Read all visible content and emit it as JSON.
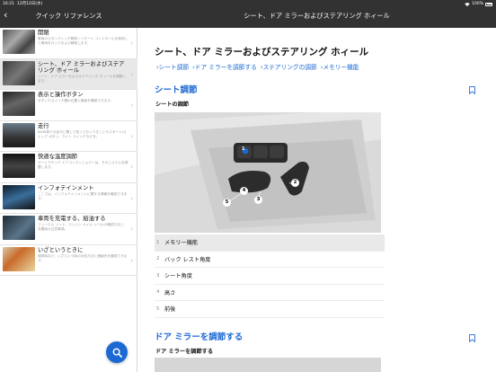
{
  "status": {
    "time": "16:21",
    "date": "12月12日(水)",
    "battery": "100%"
  },
  "sidebar": {
    "back_icon": "‹",
    "title": "クイック リファレンス",
    "items": [
      {
        "title": "開閉",
        "desc": "車両のスタンディング照明 / リモート コントロールを使用して車両をロックおよび解錠します。",
        "thumb": "t1"
      },
      {
        "title": "シート、ドア ミラーおよびステアリング ホィール",
        "desc": "シート、ドア ミラーおよびステアリング ホィールを調整します。",
        "thumb": "t2"
      },
      {
        "title": "表示と操作ボタン",
        "desc": "ボタンやスイッチ類の位置と機能を確認できます。",
        "thumb": "t3"
      },
      {
        "title": "走行",
        "desc": "BMW車での走行に関して知っておくべきことやスタート/ストップ ボタン、ライト スイッチなどを。",
        "thumb": "t4"
      },
      {
        "title": "快適な温度調節",
        "desc": "オートマチック エアコンディショナーは、そのシステムを調整します。",
        "thumb": "t5"
      },
      {
        "title": "インフォテインメント",
        "desc": "ここでは、インフォテインメントに関する情報を確認できます。",
        "thumb": "t6"
      },
      {
        "title": "車両を充電する、給油する",
        "desc": "フューエル リッド、エンジン オイル レベルの確認方法と、充電時の注意事項。",
        "thumb": "t7"
      },
      {
        "title": "いざというときに",
        "desc": "故障時など、いざという時の対処方法と連絡先を確認できます。",
        "thumb": "t8"
      }
    ],
    "chevron": "›",
    "search_icon": "search-icon"
  },
  "main": {
    "header_title": "シート、ドア ミラーおよびステアリング ホィール",
    "doc_title": "シート、ドア ミラーおよびステアリング ホィール",
    "links": [
      "›シート調節",
      "›ドア ミラーを調節する",
      "›ステアリングの調節",
      "›メモリー機能"
    ],
    "section1": {
      "title": "シート調節",
      "subtitle": "シートの調節",
      "callouts": [
        "1",
        "2",
        "3",
        "4",
        "5"
      ],
      "items": [
        {
          "num": "1",
          "label": "メモリー機能"
        },
        {
          "num": "2",
          "label": "バック レスト角度"
        },
        {
          "num": "3",
          "label": "シート角度"
        },
        {
          "num": "4",
          "label": "高さ"
        },
        {
          "num": "5",
          "label": "前後"
        }
      ]
    },
    "section2": {
      "title": "ドア ミラーを調節する",
      "subtitle": "ドア ミラーを調節する"
    }
  },
  "colors": {
    "header_bg": "#323232",
    "accent": "#1c69d4",
    "active_row": "#e8e8e8"
  }
}
